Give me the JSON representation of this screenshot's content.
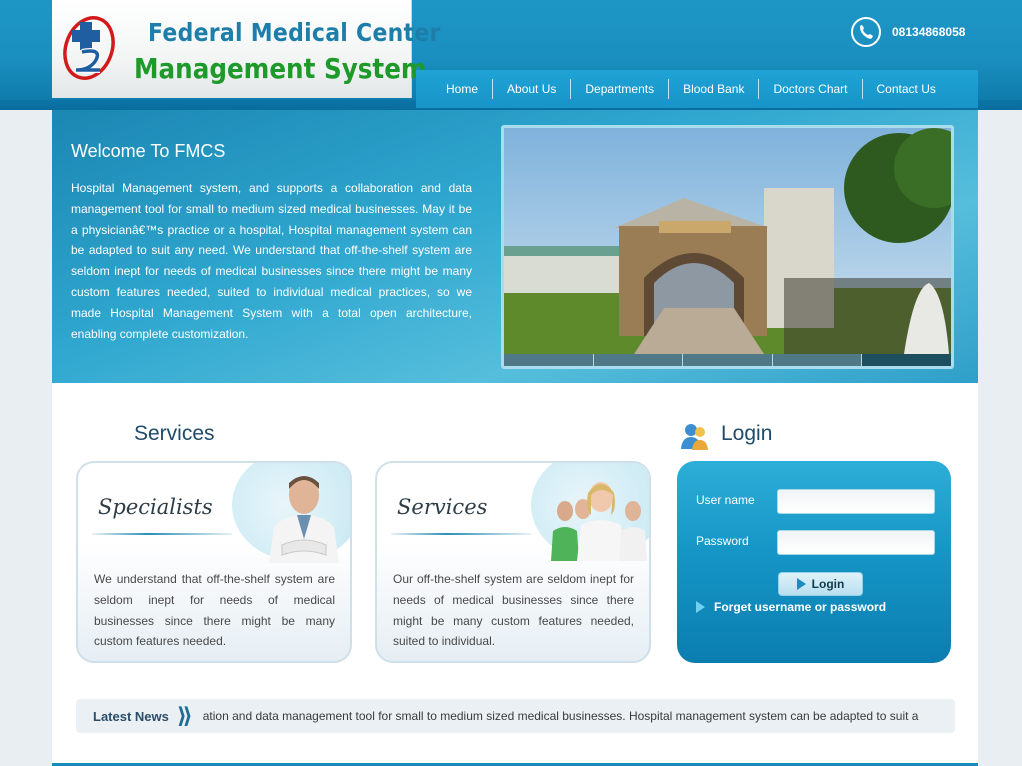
{
  "brand": {
    "line1": "Federal Medical Center",
    "line2": "Management System"
  },
  "phone": {
    "number": "08134868058",
    "icon": "phone-icon"
  },
  "nav": {
    "items": [
      {
        "label": "Home"
      },
      {
        "label": "About Us"
      },
      {
        "label": "Departments"
      },
      {
        "label": "Blood Bank"
      },
      {
        "label": "Doctors Chart"
      },
      {
        "label": "Contact Us"
      }
    ]
  },
  "hero": {
    "title": "Welcome To FMCS",
    "text": "Hospital Management system, and supports a collaboration and data management tool for small to medium sized medical businesses. May it be a physicianâ€™s practice or a hospital, Hospital management system can be adapted to suit any need. We understand that off-the-shelf system are seldom inept for needs of medical businesses since there might be many custom features needed, suited to individual medical practices, so we made Hospital Management System with a total open architecture, enabling complete customization.",
    "slider_active_index": 4
  },
  "services": {
    "heading": "Services",
    "cards": [
      {
        "title": "Specialists",
        "text": "We understand that off-the-shelf system are seldom inept for needs of medical businesses since there might be many custom features needed."
      },
      {
        "title": "Services",
        "text": "Our off-the-shelf system are seldom inept for needs of medical businesses since there might be many custom features needed, suited to individual."
      }
    ]
  },
  "login": {
    "heading": "Login",
    "username_label": "User name",
    "username_value": "",
    "password_label": "Password",
    "password_value": "",
    "button_label": "Login",
    "forgot_label": "Forget username or password"
  },
  "news": {
    "label": "Latest News",
    "ticker": "ation and data management tool for small to medium sized medical businesses. Hospital management system can be adapted to suit a"
  },
  "colors": {
    "header_blue": "#1d96c6",
    "logo_blue": "#1d7fa9",
    "logo_green": "#1e9a2a",
    "heading_dark": "#1e4b6a"
  }
}
